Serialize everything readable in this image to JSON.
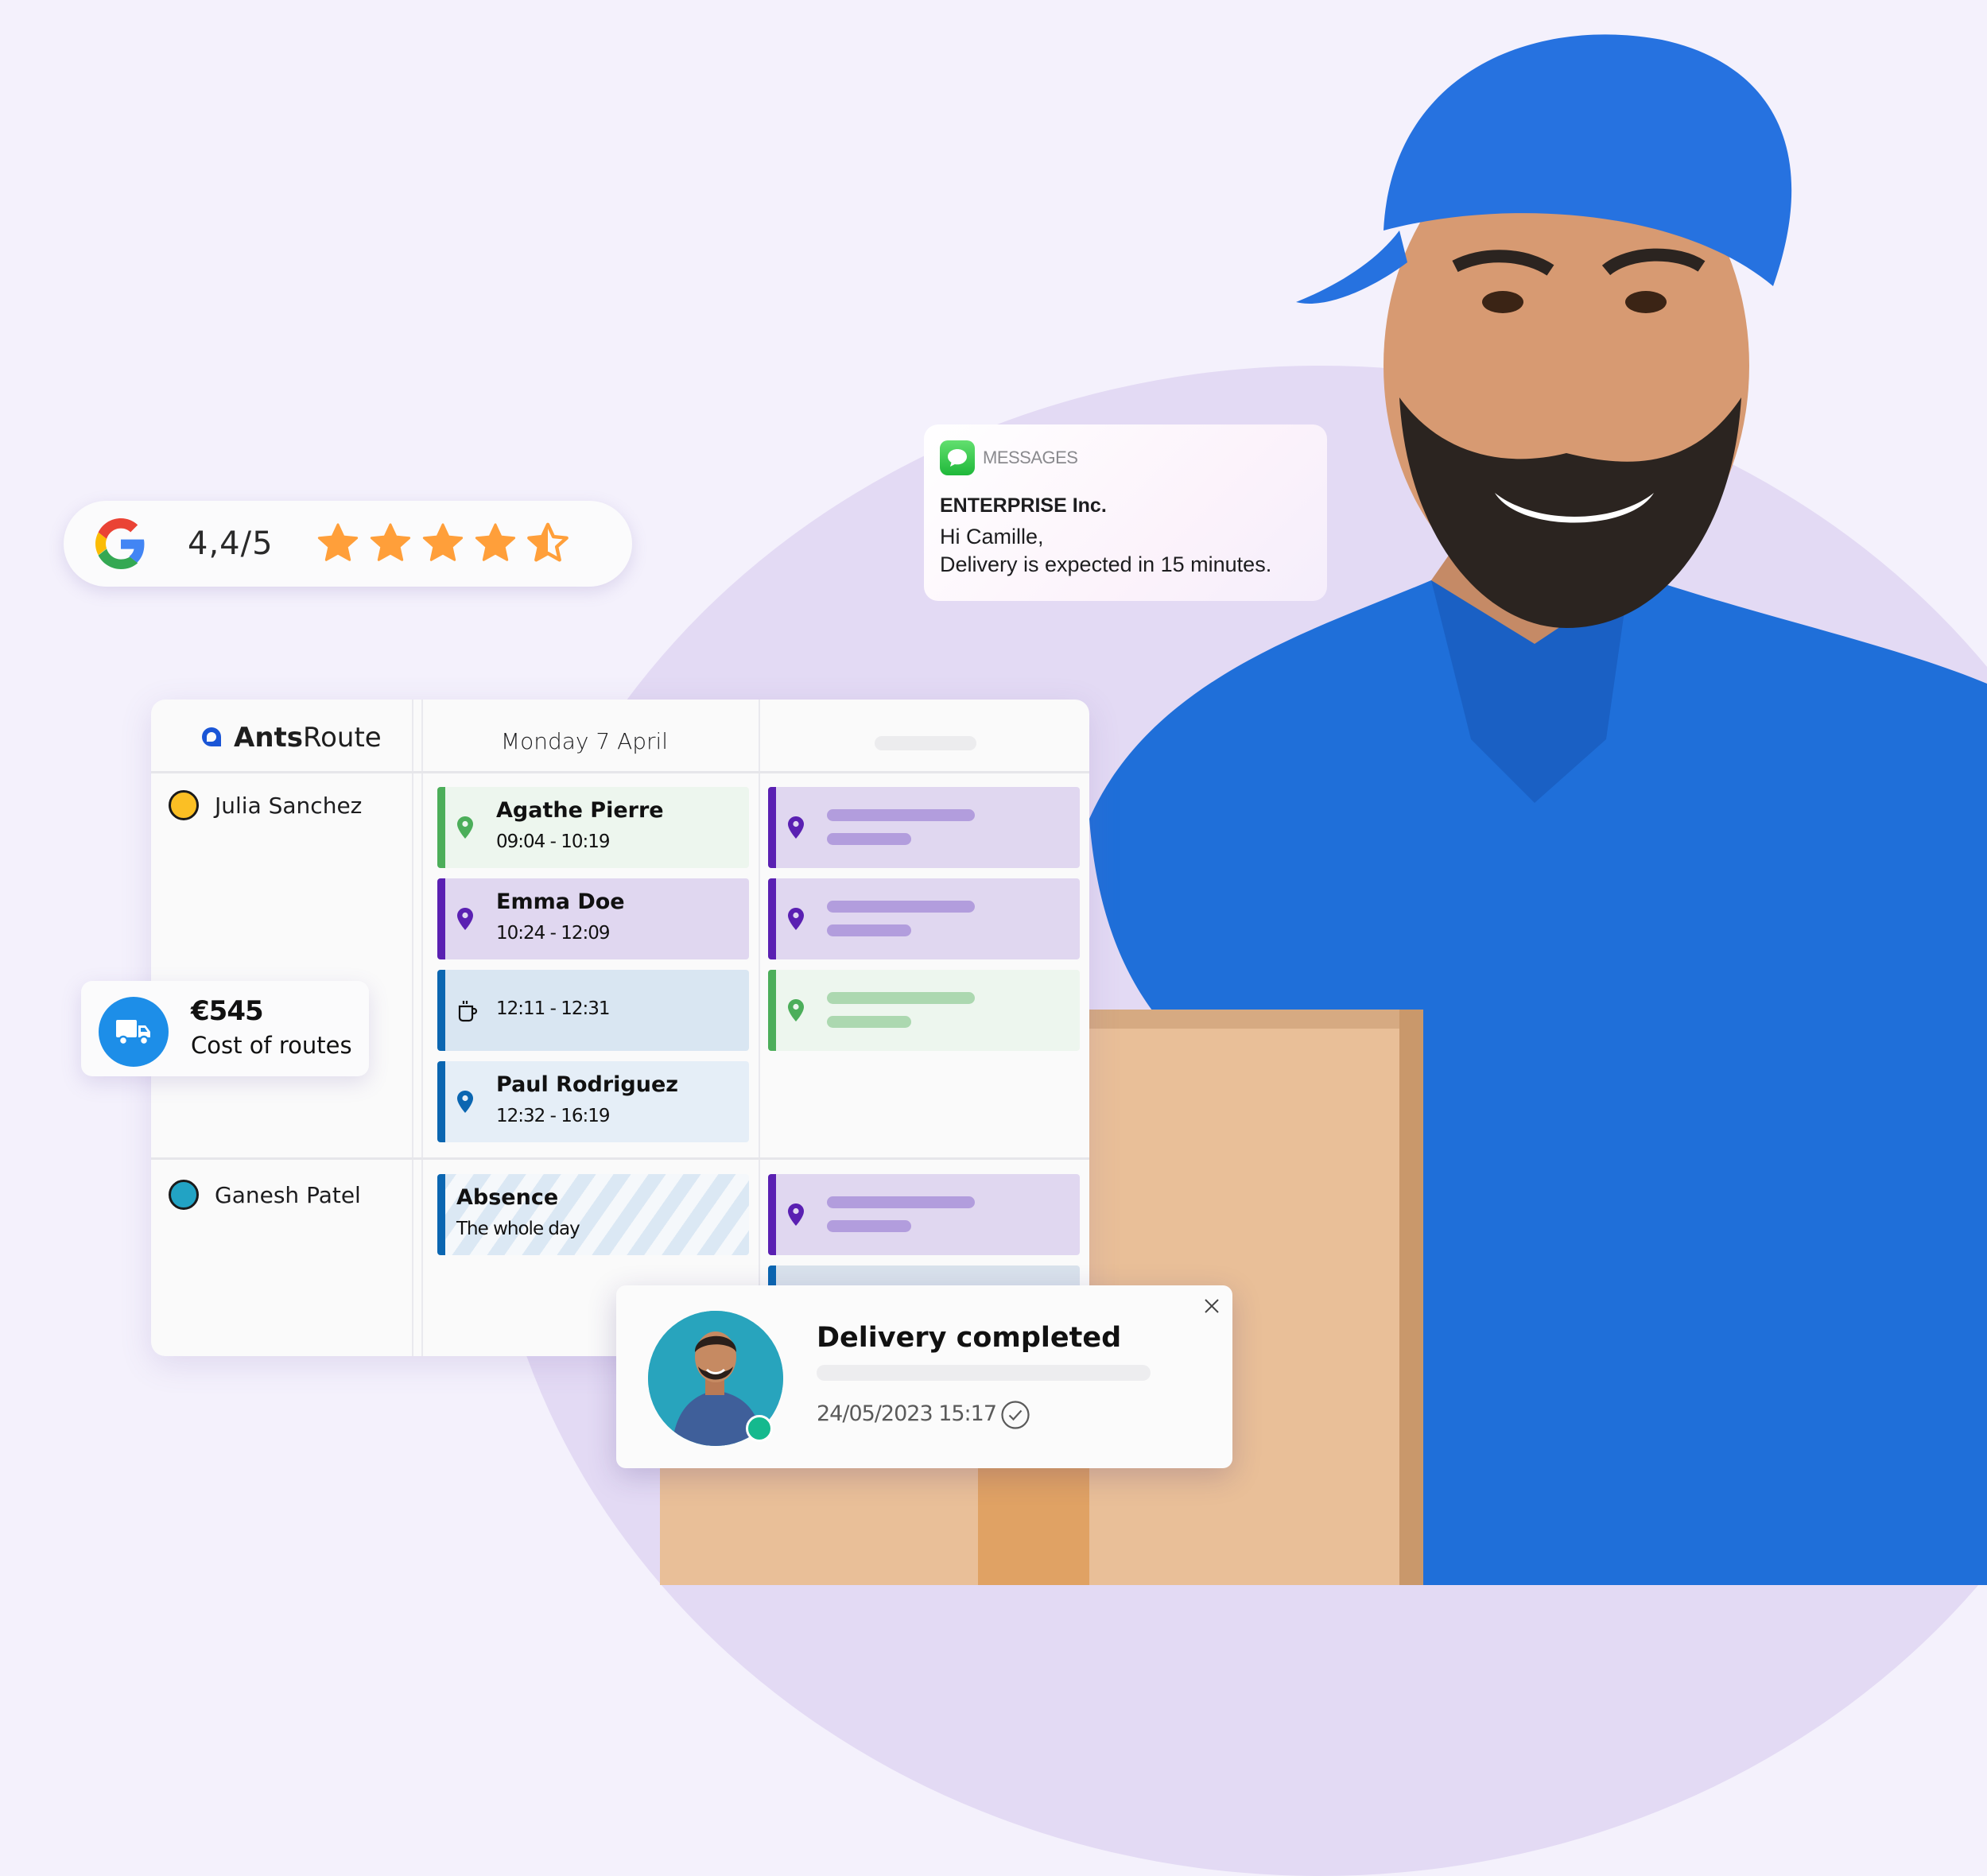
{
  "rating": {
    "provider_icon": "google-g-logo",
    "score": "4,4/5",
    "stars_value": 4.4,
    "stars_max": 5,
    "star_color": "#ff9f3a"
  },
  "message_notification": {
    "app_icon": "messages-bubble-icon",
    "app_name": "MESSAGES",
    "sender": "ENTERPRISE Inc.",
    "body_line1": "Hi Camille,",
    "body_line2": "Delivery is expected in 15 minutes."
  },
  "planner": {
    "brand": {
      "bold": "Ants",
      "regular": "Route",
      "logo_color": "#1a55d6"
    },
    "day_header": "Monday 7 April",
    "drivers": [
      {
        "name": "Julia Sanchez",
        "color": "#fbbf24"
      },
      {
        "name": "Ganesh Patel",
        "color": "#22a3c4"
      }
    ],
    "tasks": [
      {
        "type": "stop",
        "title": "Agathe Pierre",
        "time": "09:04 - 10:19",
        "accent": "#4cae5a",
        "bg": "#edf6ee"
      },
      {
        "type": "stop",
        "title": "Emma Doe",
        "time": "10:24 - 12:09",
        "accent": "#5a20b2",
        "bg": "#e0d7f0"
      },
      {
        "type": "break",
        "title": "",
        "time": "12:11 - 12:31",
        "accent": "#0b66b1",
        "bg": "#d9e6f2"
      },
      {
        "type": "stop",
        "title": "Paul Rodriguez",
        "time": "12:32 - 16:19",
        "accent": "#0b66b1",
        "bg": "#e5eef7"
      },
      {
        "type": "absence",
        "title": "Absence",
        "time": "The whole day",
        "accent": "#0b66b1"
      }
    ],
    "placeholder_tasks": [
      {
        "accent": "#5a20b2",
        "bg": "#e0d7f0",
        "skeleton": "#b29ddd"
      },
      {
        "accent": "#5a20b2",
        "bg": "#e0d7f0",
        "skeleton": "#b29ddd"
      },
      {
        "accent": "#4cae5a",
        "bg": "#edf6ee",
        "skeleton": "#acd8b0"
      },
      {
        "accent": "#5a20b2",
        "bg": "#e0d7f0",
        "skeleton": "#b29ddd"
      }
    ]
  },
  "cost_card": {
    "icon": "truck-icon",
    "amount": "€545",
    "label": "Cost of routes"
  },
  "delivery_toast": {
    "title": "Delivery completed",
    "timestamp": "24/05/2023 15:17",
    "status_icon": "check-circle-icon",
    "close_icon": "close-icon"
  }
}
